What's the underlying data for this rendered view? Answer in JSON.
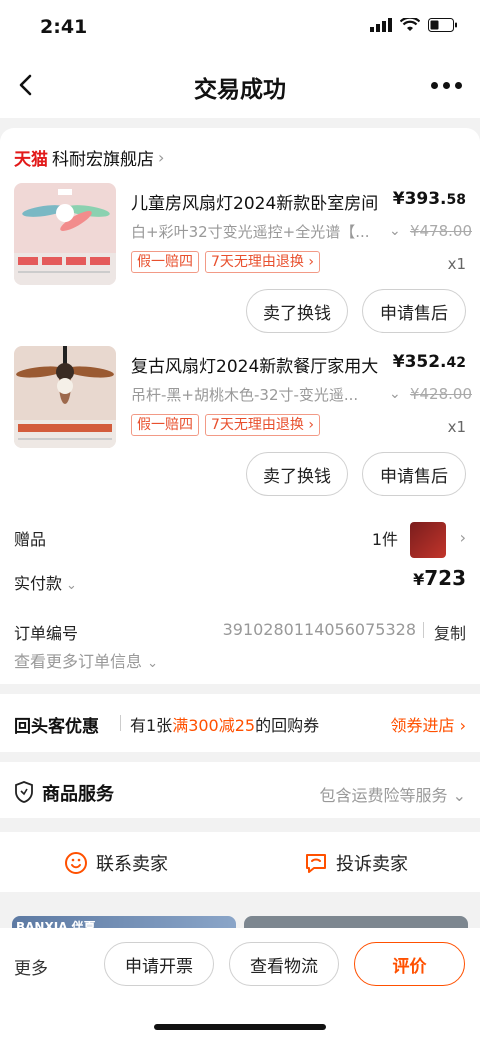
{
  "status_bar": {
    "time": "2:41"
  },
  "nav": {
    "title": "交易成功"
  },
  "shop": {
    "platform": "天猫",
    "name": "科耐宏旗舰店"
  },
  "items": [
    {
      "title": "儿童房风扇灯2024新款卧室房间",
      "price_int": "¥393.",
      "price_dec": "58",
      "sku": "白+彩叶32寸变光遥控+全光谱【...",
      "original_price": "¥478.00",
      "tags": [
        "假一赔四",
        "7天无理由退换"
      ],
      "qty": "x1",
      "buttons": {
        "sell": "卖了换钱",
        "after_sale": "申请售后"
      }
    },
    {
      "title": "复古风扇灯2024新款餐厅家用大",
      "price_int": "¥352.",
      "price_dec": "42",
      "sku": "吊杆-黑+胡桃木色-32寸-变光遥...",
      "original_price": "¥428.00",
      "tags": [
        "假一赔四",
        "7天无理由退换"
      ],
      "qty": "x1",
      "buttons": {
        "sell": "卖了换钱",
        "after_sale": "申请售后"
      }
    }
  ],
  "gift": {
    "label": "赠品",
    "count": "1件"
  },
  "paid": {
    "label": "实付款",
    "currency": "¥",
    "amount": "723"
  },
  "order": {
    "label": "订单编号",
    "number": "3910280114056075328",
    "copy": "复制",
    "more": "查看更多订单信息"
  },
  "returning": {
    "title": "回头客优惠",
    "desc_prefix": "有1张",
    "desc_highlight": "满300减25",
    "desc_suffix": "的回购券",
    "link": "领券进店"
  },
  "service": {
    "title": "商品服务",
    "desc": "包含运费险等服务"
  },
  "contact": {
    "seller": "联系卖家",
    "complain": "投诉卖家"
  },
  "reco": {
    "brand": "BANXIA 伴夏"
  },
  "bottom": {
    "more": "更多",
    "invoice": "申请开票",
    "logistics": "查看物流",
    "review": "评价"
  },
  "colors": {
    "accent": "#ff5000",
    "tmall": "#e21a1a"
  }
}
